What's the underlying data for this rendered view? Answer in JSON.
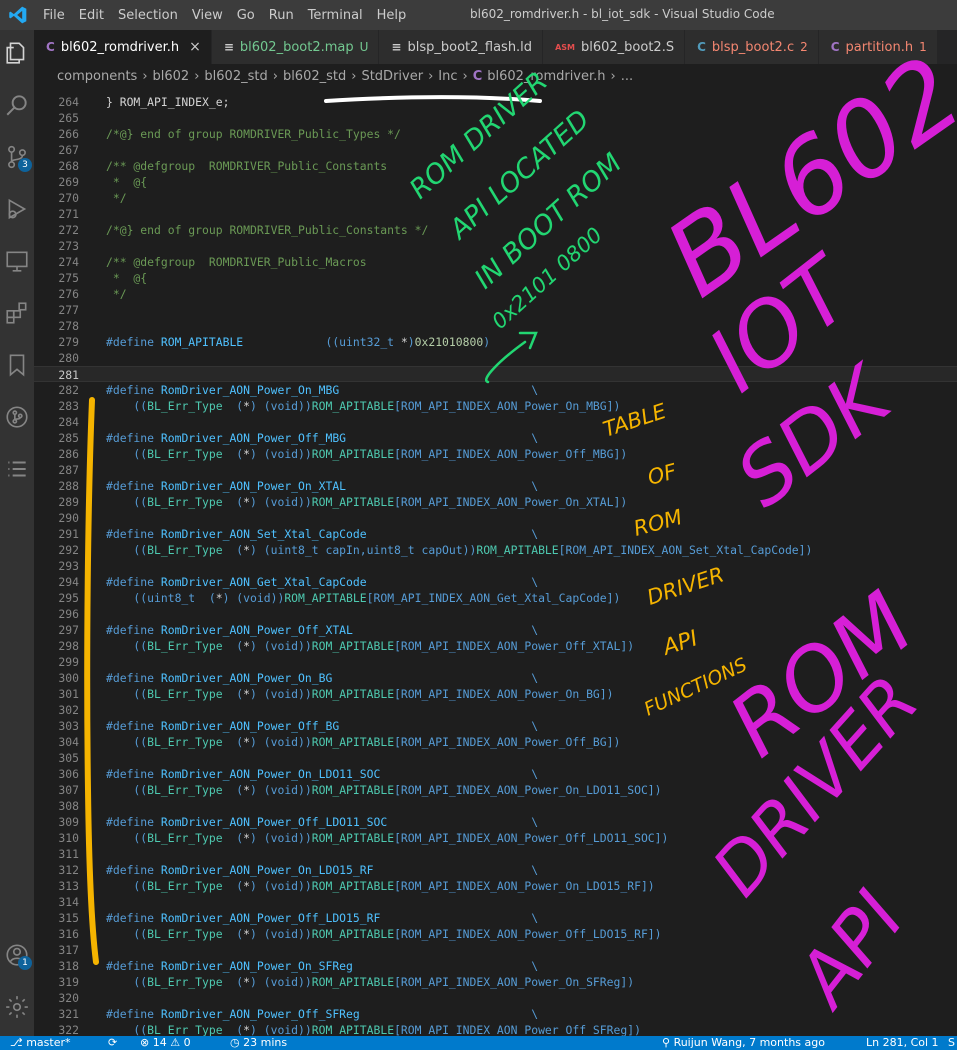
{
  "titlebar": {
    "menu": [
      "File",
      "Edit",
      "Selection",
      "View",
      "Go",
      "Run",
      "Terminal",
      "Help"
    ],
    "title": "bl602_romdriver.h - bl_iot_sdk - Visual Studio Code"
  },
  "activity": {
    "scm_badge": "3",
    "account_badge": "1"
  },
  "tabs": [
    {
      "icon": "C",
      "label": "bl602_romdriver.h",
      "suffix": "×",
      "icon_color": "#a074c4",
      "label_color": "#ffffff"
    },
    {
      "icon": "≡",
      "label": "bl602_boot2.map",
      "suffix": "U",
      "icon_color": "#cccccc",
      "label_color": "#73c991"
    },
    {
      "icon": "≡",
      "label": "blsp_boot2_flash.ld",
      "suffix": "",
      "icon_color": "#cccccc",
      "label_color": "#cccccc"
    },
    {
      "icon": "ASM",
      "label": "bl602_boot2.S",
      "suffix": "",
      "icon_color": "#e44d4d",
      "label_color": "#cccccc"
    },
    {
      "icon": "C",
      "label": "blsp_boot2.c",
      "suffix": "2",
      "icon_color": "#519aba",
      "label_color": "#f48771"
    },
    {
      "icon": "C",
      "label": "partition.h",
      "suffix": "1",
      "icon_color": "#a074c4",
      "label_color": "#f48771"
    }
  ],
  "breadcrumb": [
    "components",
    "bl602",
    "bl602_std",
    "bl602_std",
    "StdDriver",
    "Inc",
    "C",
    "bl602_romdriver.h",
    "..."
  ],
  "code": [
    {
      "n": "264",
      "parts": [
        [
          "} ROM_API_INDEX_e;",
          "txt"
        ]
      ]
    },
    {
      "n": "265",
      "parts": []
    },
    {
      "n": "266",
      "parts": [
        [
          "/*@} end of group ROMDRIVER_Public_Types */",
          "com"
        ]
      ]
    },
    {
      "n": "267",
      "parts": []
    },
    {
      "n": "268",
      "parts": [
        [
          "/** @defgroup  ROMDRIVER_Public_Constants",
          "com"
        ]
      ]
    },
    {
      "n": "269",
      "parts": [
        [
          " *  @{",
          "com"
        ]
      ]
    },
    {
      "n": "270",
      "parts": [
        [
          " */",
          "com"
        ]
      ]
    },
    {
      "n": "271",
      "parts": []
    },
    {
      "n": "272",
      "parts": [
        [
          "/*@} end of group ROMDRIVER_Public_Constants */",
          "com"
        ]
      ]
    },
    {
      "n": "273",
      "parts": []
    },
    {
      "n": "274",
      "parts": [
        [
          "/** @defgroup  ROMDRIVER_Public_Macros",
          "com"
        ]
      ]
    },
    {
      "n": "275",
      "parts": [
        [
          " *  @{",
          "com"
        ]
      ]
    },
    {
      "n": "276",
      "parts": [
        [
          " */",
          "com"
        ]
      ]
    },
    {
      "n": "277",
      "parts": []
    },
    {
      "n": "278",
      "parts": []
    },
    {
      "n": "279",
      "parts": [
        [
          "#define",
          "dir"
        ],
        [
          " ROM_APITABLE",
          "mac"
        ],
        [
          "            ((uint32_t ",
          "dir"
        ],
        [
          "*",
          "ptr"
        ],
        [
          ")",
          "dir"
        ],
        [
          "0x21010800",
          "num"
        ],
        [
          ")",
          "dir"
        ]
      ]
    },
    {
      "n": "280",
      "parts": []
    },
    {
      "n": "281",
      "parts": [],
      "current": true
    },
    {
      "n": "282",
      "parts": [
        [
          "#define",
          "dir"
        ],
        [
          " RomDriver_AON_Power_On_MBG",
          "mac"
        ],
        [
          "                            \\",
          "dir"
        ]
      ]
    },
    {
      "n": "283",
      "parts": [
        [
          "    ((",
          "dir"
        ],
        [
          "BL_Err_Type",
          "def"
        ],
        [
          "  (",
          "dir"
        ],
        [
          "*",
          "ptr"
        ],
        [
          ") (void))",
          "dir"
        ],
        [
          "ROM_APITABLE",
          "def"
        ],
        [
          "[ROM_API_INDEX_AON_Power_On_MBG])",
          "dir"
        ]
      ]
    },
    {
      "n": "284",
      "parts": []
    },
    {
      "n": "285",
      "parts": [
        [
          "#define",
          "dir"
        ],
        [
          " RomDriver_AON_Power_Off_MBG",
          "mac"
        ],
        [
          "                           \\",
          "dir"
        ]
      ]
    },
    {
      "n": "286",
      "parts": [
        [
          "    ((",
          "dir"
        ],
        [
          "BL_Err_Type",
          "def"
        ],
        [
          "  (",
          "dir"
        ],
        [
          "*",
          "ptr"
        ],
        [
          ") (void))",
          "dir"
        ],
        [
          "ROM_APITABLE",
          "def"
        ],
        [
          "[ROM_API_INDEX_AON_Power_Off_MBG])",
          "dir"
        ]
      ]
    },
    {
      "n": "287",
      "parts": []
    },
    {
      "n": "288",
      "parts": [
        [
          "#define",
          "dir"
        ],
        [
          " RomDriver_AON_Power_On_XTAL",
          "mac"
        ],
        [
          "                           \\",
          "dir"
        ]
      ]
    },
    {
      "n": "289",
      "parts": [
        [
          "    ((",
          "dir"
        ],
        [
          "BL_Err_Type",
          "def"
        ],
        [
          "  (",
          "dir"
        ],
        [
          "*",
          "ptr"
        ],
        [
          ") (void))",
          "dir"
        ],
        [
          "ROM_APITABLE",
          "def"
        ],
        [
          "[ROM_API_INDEX_AON_Power_On_XTAL])",
          "dir"
        ]
      ]
    },
    {
      "n": "290",
      "parts": []
    },
    {
      "n": "291",
      "parts": [
        [
          "#define",
          "dir"
        ],
        [
          " RomDriver_AON_Set_Xtal_CapCode",
          "mac"
        ],
        [
          "                        \\",
          "dir"
        ]
      ]
    },
    {
      "n": "292",
      "parts": [
        [
          "    ((",
          "dir"
        ],
        [
          "BL_Err_Type",
          "def"
        ],
        [
          "  (",
          "dir"
        ],
        [
          "*",
          "ptr"
        ],
        [
          ") (uint8_t capIn,uint8_t capOut))",
          "dir"
        ],
        [
          "ROM_APITABLE",
          "def"
        ],
        [
          "[ROM_API_INDEX_AON_Set_Xtal_CapCode])",
          "dir"
        ]
      ]
    },
    {
      "n": "293",
      "parts": []
    },
    {
      "n": "294",
      "parts": [
        [
          "#define",
          "dir"
        ],
        [
          " RomDriver_AON_Get_Xtal_CapCode",
          "mac"
        ],
        [
          "                        \\",
          "dir"
        ]
      ]
    },
    {
      "n": "295",
      "parts": [
        [
          "    ((uint8_t  (",
          "dir"
        ],
        [
          "*",
          "ptr"
        ],
        [
          ") (void))",
          "dir"
        ],
        [
          "ROM_APITABLE",
          "def"
        ],
        [
          "[ROM_API_INDEX_AON_Get_Xtal_CapCode])",
          "dir"
        ]
      ]
    },
    {
      "n": "296",
      "parts": []
    },
    {
      "n": "297",
      "parts": [
        [
          "#define",
          "dir"
        ],
        [
          " RomDriver_AON_Power_Off_XTAL",
          "mac"
        ],
        [
          "                          \\",
          "dir"
        ]
      ]
    },
    {
      "n": "298",
      "parts": [
        [
          "    ((",
          "dir"
        ],
        [
          "BL_Err_Type",
          "def"
        ],
        [
          "  (",
          "dir"
        ],
        [
          "*",
          "ptr"
        ],
        [
          ") (void))",
          "dir"
        ],
        [
          "ROM_APITABLE",
          "def"
        ],
        [
          "[ROM_API_INDEX_AON_Power_Off_XTAL])",
          "dir"
        ]
      ]
    },
    {
      "n": "299",
      "parts": []
    },
    {
      "n": "300",
      "parts": [
        [
          "#define",
          "dir"
        ],
        [
          " RomDriver_AON_Power_On_BG",
          "mac"
        ],
        [
          "                             \\",
          "dir"
        ]
      ]
    },
    {
      "n": "301",
      "parts": [
        [
          "    ((",
          "dir"
        ],
        [
          "BL_Err_Type",
          "def"
        ],
        [
          "  (",
          "dir"
        ],
        [
          "*",
          "ptr"
        ],
        [
          ") (void))",
          "dir"
        ],
        [
          "ROM_APITABLE",
          "def"
        ],
        [
          "[ROM_API_INDEX_AON_Power_On_BG])",
          "dir"
        ]
      ]
    },
    {
      "n": "302",
      "parts": []
    },
    {
      "n": "303",
      "parts": [
        [
          "#define",
          "dir"
        ],
        [
          " RomDriver_AON_Power_Off_BG",
          "mac"
        ],
        [
          "                            \\",
          "dir"
        ]
      ]
    },
    {
      "n": "304",
      "parts": [
        [
          "    ((",
          "dir"
        ],
        [
          "BL_Err_Type",
          "def"
        ],
        [
          "  (",
          "dir"
        ],
        [
          "*",
          "ptr"
        ],
        [
          ") (void))",
          "dir"
        ],
        [
          "ROM_APITABLE",
          "def"
        ],
        [
          "[ROM_API_INDEX_AON_Power_Off_BG])",
          "dir"
        ]
      ]
    },
    {
      "n": "305",
      "parts": []
    },
    {
      "n": "306",
      "parts": [
        [
          "#define",
          "dir"
        ],
        [
          " RomDriver_AON_Power_On_LDO11_SOC",
          "mac"
        ],
        [
          "                      \\",
          "dir"
        ]
      ]
    },
    {
      "n": "307",
      "parts": [
        [
          "    ((",
          "dir"
        ],
        [
          "BL_Err_Type",
          "def"
        ],
        [
          "  (",
          "dir"
        ],
        [
          "*",
          "ptr"
        ],
        [
          ") (void))",
          "dir"
        ],
        [
          "ROM_APITABLE",
          "def"
        ],
        [
          "[ROM_API_INDEX_AON_Power_On_LDO11_SOC])",
          "dir"
        ]
      ]
    },
    {
      "n": "308",
      "parts": []
    },
    {
      "n": "309",
      "parts": [
        [
          "#define",
          "dir"
        ],
        [
          " RomDriver_AON_Power_Off_LDO11_SOC",
          "mac"
        ],
        [
          "                     \\",
          "dir"
        ]
      ]
    },
    {
      "n": "310",
      "parts": [
        [
          "    ((",
          "dir"
        ],
        [
          "BL_Err_Type",
          "def"
        ],
        [
          "  (",
          "dir"
        ],
        [
          "*",
          "ptr"
        ],
        [
          ") (void))",
          "dir"
        ],
        [
          "ROM_APITABLE",
          "def"
        ],
        [
          "[ROM_API_INDEX_AON_Power_Off_LDO11_SOC])",
          "dir"
        ]
      ]
    },
    {
      "n": "311",
      "parts": []
    },
    {
      "n": "312",
      "parts": [
        [
          "#define",
          "dir"
        ],
        [
          " RomDriver_AON_Power_On_LDO15_RF",
          "mac"
        ],
        [
          "                       \\",
          "dir"
        ]
      ]
    },
    {
      "n": "313",
      "parts": [
        [
          "    ((",
          "dir"
        ],
        [
          "BL_Err_Type",
          "def"
        ],
        [
          "  (",
          "dir"
        ],
        [
          "*",
          "ptr"
        ],
        [
          ") (void))",
          "dir"
        ],
        [
          "ROM_APITABLE",
          "def"
        ],
        [
          "[ROM_API_INDEX_AON_Power_On_LDO15_RF])",
          "dir"
        ]
      ]
    },
    {
      "n": "314",
      "parts": []
    },
    {
      "n": "315",
      "parts": [
        [
          "#define",
          "dir"
        ],
        [
          " RomDriver_AON_Power_Off_LDO15_RF",
          "mac"
        ],
        [
          "                      \\",
          "dir"
        ]
      ]
    },
    {
      "n": "316",
      "parts": [
        [
          "    ((",
          "dir"
        ],
        [
          "BL_Err_Type",
          "def"
        ],
        [
          "  (",
          "dir"
        ],
        [
          "*",
          "ptr"
        ],
        [
          ") (void))",
          "dir"
        ],
        [
          "ROM_APITABLE",
          "def"
        ],
        [
          "[ROM_API_INDEX_AON_Power_Off_LDO15_RF])",
          "dir"
        ]
      ]
    },
    {
      "n": "317",
      "parts": []
    },
    {
      "n": "318",
      "parts": [
        [
          "#define",
          "dir"
        ],
        [
          " RomDriver_AON_Power_On_SFReg",
          "mac"
        ],
        [
          "                          \\",
          "dir"
        ]
      ]
    },
    {
      "n": "319",
      "parts": [
        [
          "    ((",
          "dir"
        ],
        [
          "BL_Err_Type",
          "def"
        ],
        [
          "  (",
          "dir"
        ],
        [
          "*",
          "ptr"
        ],
        [
          ") (void))",
          "dir"
        ],
        [
          "ROM_APITABLE",
          "def"
        ],
        [
          "[ROM_API_INDEX_AON_Power_On_SFReg])",
          "dir"
        ]
      ]
    },
    {
      "n": "320",
      "parts": []
    },
    {
      "n": "321",
      "parts": [
        [
          "#define",
          "dir"
        ],
        [
          " RomDriver_AON_Power_Off_SFReg",
          "mac"
        ],
        [
          "                         \\",
          "dir"
        ]
      ]
    },
    {
      "n": "322",
      "parts": [
        [
          "    ((",
          "dir"
        ],
        [
          "BL_Err_Type",
          "def"
        ],
        [
          "  (",
          "dir"
        ],
        [
          "*",
          "ptr"
        ],
        [
          ") (void))",
          "dir"
        ],
        [
          "ROM_APITABLE",
          "def"
        ],
        [
          "[ROM_API_INDEX_AON_Power_Off_SFReg])",
          "dir"
        ]
      ]
    }
  ],
  "annotations": {
    "green": [
      "ROM DRIVER",
      "API LOCATED",
      "IN BOOT ROM",
      "0x2101 0800"
    ],
    "orange": [
      "TABLE",
      "OF",
      "ROM",
      "DRIVER",
      "API",
      "FUNCTIONS"
    ],
    "magenta": [
      "BL602",
      "IOT",
      "SDK",
      "ROM",
      "DRIVER",
      "API"
    ],
    "colors": {
      "green": "#22d672",
      "orange": "#f5b400",
      "magenta": "#d61fd6",
      "ink_white": "#ffffff"
    }
  },
  "status": {
    "branch": "master*",
    "errors": "14",
    "warnings": "0",
    "time": "23 mins",
    "blame": "Ruijun Wang, 7 months ago",
    "cursor": "Ln 281, Col 1",
    "extra": "S"
  }
}
